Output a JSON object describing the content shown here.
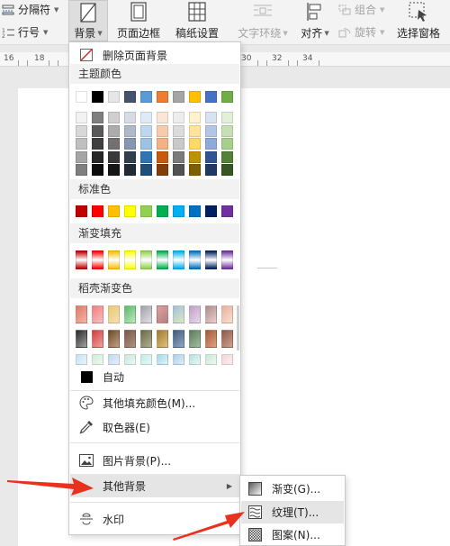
{
  "toolbar": {
    "separator_label": "分隔符",
    "line_number_label": "行号",
    "background_label": "背景",
    "page_border_label": "页面边框",
    "paper_setup_label": "稿纸设置",
    "text_wrap_label": "文字环绕",
    "align_label": "对齐",
    "group_label": "组合",
    "rotate_label": "旋转",
    "selection_pane_label": "选择窗格"
  },
  "ruler": {
    "left_numbers": [
      "16",
      "18"
    ],
    "right_numbers": [
      "30",
      "32",
      "34"
    ]
  },
  "menu": {
    "remove_background": "删除页面背景",
    "theme_colors_title": "主题颜色",
    "standard_colors_title": "标准色",
    "gradient_fill_title": "渐变填充",
    "rice_husk_gradient_title": "稻壳渐变色",
    "auto_label": "自动",
    "more_fill_colors": "其他填充颜色(M)...",
    "eyedropper": "取色器(E)",
    "picture_background": "图片背景(P)...",
    "other_background": "其他背景",
    "watermark": "水印"
  },
  "submenu": {
    "gradient": "渐变(G)...",
    "texture": "纹理(T)...",
    "pattern": "图案(N)..."
  },
  "colors": {
    "theme_row": [
      "#ffffff",
      "#000000",
      "#e7e6e6",
      "#44546a",
      "#5b9bd5",
      "#ed7d31",
      "#a5a5a5",
      "#ffc000",
      "#4472c4",
      "#70ad47"
    ],
    "theme_shades": [
      [
        "#f2f2f2",
        "#7f7f7f",
        "#d0cece",
        "#d6dce4",
        "#deebf6",
        "#fbe5d5",
        "#ededed",
        "#fff2cc",
        "#d9e2f3",
        "#e2efd9"
      ],
      [
        "#d8d8d8",
        "#595959",
        "#aeabab",
        "#adb9ca",
        "#bdd7ee",
        "#f7cbac",
        "#dbdbdb",
        "#fee599",
        "#b4c6e7",
        "#c5e0b3"
      ],
      [
        "#bfbfbf",
        "#3f3f3f",
        "#757070",
        "#8496b0",
        "#9cc3e5",
        "#f4b183",
        "#c9c9c9",
        "#ffd965",
        "#8eaadb",
        "#a8d08d"
      ],
      [
        "#a5a5a5",
        "#262626",
        "#3a3838",
        "#323f4f",
        "#2e75b5",
        "#c55a11",
        "#7b7b7b",
        "#bf9000",
        "#2f5496",
        "#538135"
      ],
      [
        "#7f7f7f",
        "#0c0c0c",
        "#171616",
        "#222a35",
        "#1e4e79",
        "#833c0b",
        "#525252",
        "#7f6000",
        "#1f3864",
        "#375623"
      ]
    ],
    "standard_row": [
      "#c00000",
      "#ff0000",
      "#ffc000",
      "#ffff00",
      "#92d050",
      "#00b050",
      "#00b0f0",
      "#0070c0",
      "#002060",
      "#7030a0"
    ],
    "gradient_row": [
      "#c00000",
      "#ff0000",
      "#ffc000",
      "#ffff00",
      "#92d050",
      "#00b050",
      "#00b0f0",
      "#0070c0",
      "#002060",
      "#7030a0"
    ],
    "rice_husk_rows": [
      [
        [
          "#e07a6a",
          "#f2b4a8"
        ],
        [
          "#f08080",
          "#f6c0c0"
        ],
        [
          "#e9c87a",
          "#f4e0b0"
        ],
        [
          "#5cb86a",
          "#c0e8c0"
        ],
        [
          "#a0a0a8",
          "#e0e0e4"
        ],
        [
          "#e0a0a0",
          "#b08080"
        ],
        [
          "#a0c0e0",
          "#e0e8c0"
        ],
        [
          "#c0a0c8",
          "#e8d8e8"
        ],
        [
          "#b08a8a",
          "#e8d0d0"
        ],
        [
          "#e8b0a0",
          "#f8e0d0"
        ]
      ],
      [
        [
          "#2a2a2a",
          "#a0a0a0"
        ],
        [
          "#d04040",
          "#f0a0a0"
        ],
        [
          "#6a4a2a",
          "#c0a080"
        ],
        [
          "#7a5a4a",
          "#b09080"
        ],
        [
          "#6a6a4a",
          "#b0b090"
        ],
        [
          "#a07a30",
          "#e0c080"
        ],
        [
          "#405a7a",
          "#90a8c8"
        ],
        [
          "#5a7a5a",
          "#a0c0a0"
        ],
        [
          "#a05a3a",
          "#e0a080"
        ],
        [
          "#8a5a4a",
          "#d0a090"
        ]
      ],
      [
        [
          "#c8e0f0",
          "#e8f4fa"
        ],
        [
          "#d0ecd8",
          "#eef8f0"
        ],
        [
          "#c0d8f0",
          "#e8f0fa"
        ],
        [
          "#c8e8e0",
          "#ecf8f4"
        ],
        [
          "#c0ece8",
          "#e8f8f6"
        ],
        [
          "#a0d8e8",
          "#e0f4f8"
        ],
        [
          "#a8d0e8",
          "#e0eef8"
        ],
        [
          "#b8e0e0",
          "#e8f6f6"
        ],
        [
          "#c8e8d8",
          "#eef8f0"
        ],
        [
          "#f0d8d8",
          "#faeeee"
        ]
      ]
    ]
  }
}
